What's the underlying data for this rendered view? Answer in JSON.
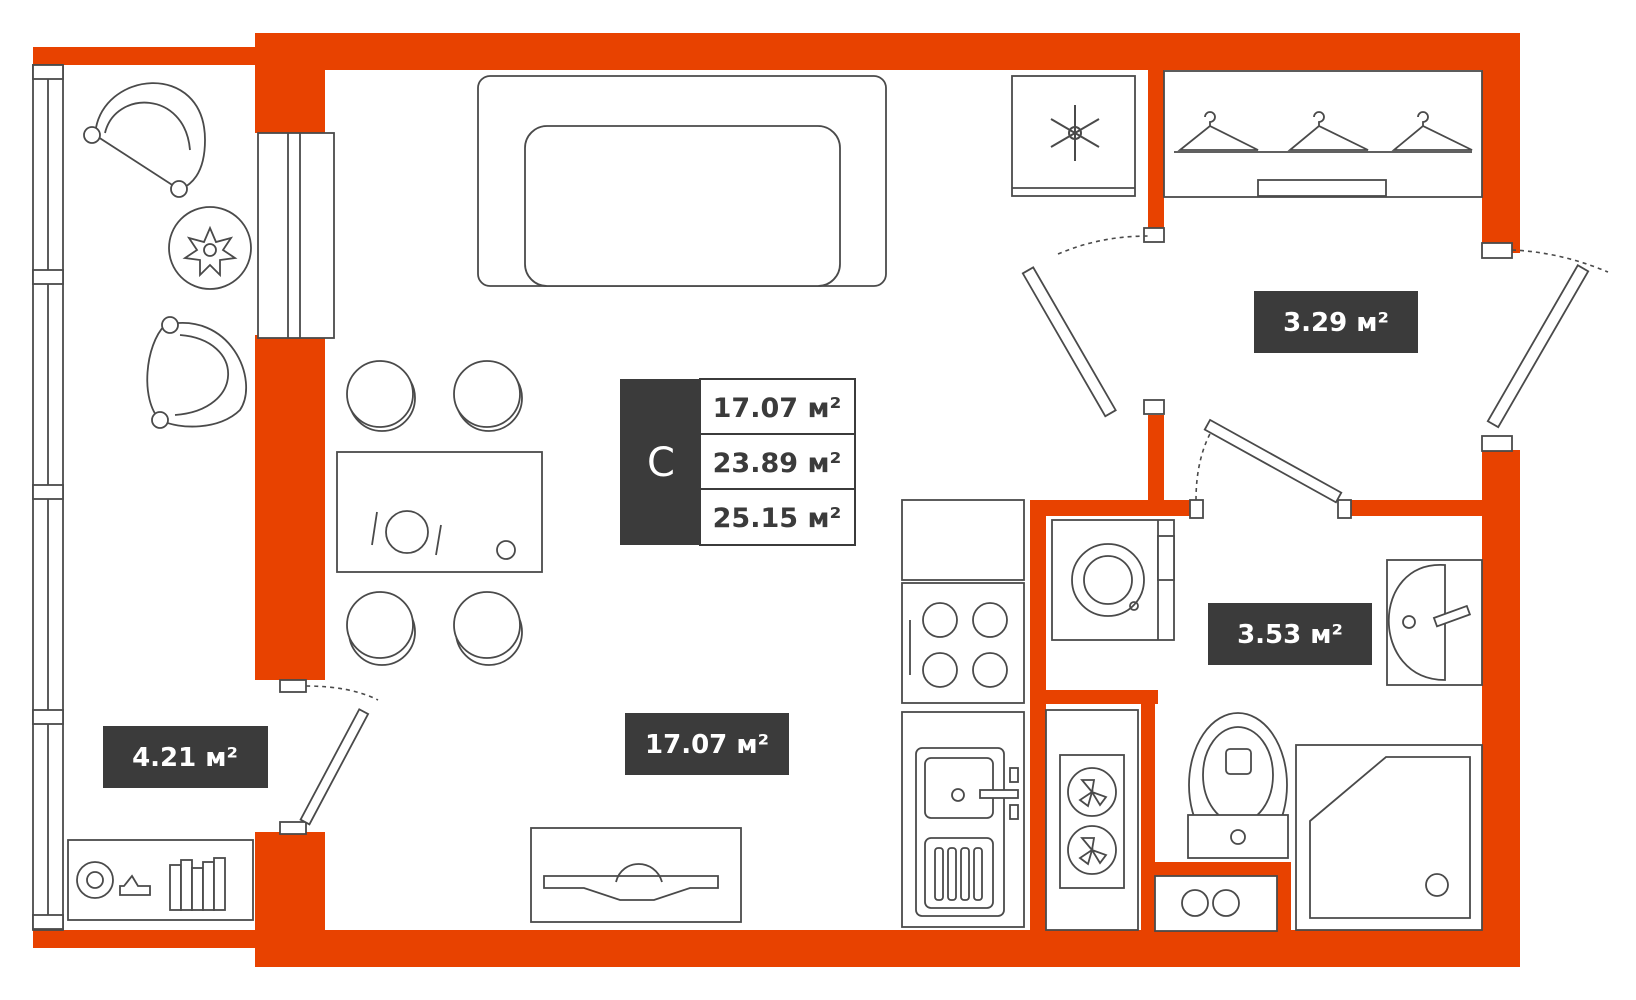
{
  "plan": {
    "colors": {
      "wall": "#e84200",
      "label_bg": "#3b3b3b",
      "line": "#4a4a4a"
    },
    "summary": {
      "type_letter": "С",
      "areas": [
        "17.07 м²",
        "23.89 м²",
        "25.15 м²"
      ]
    },
    "rooms": {
      "main_room": "17.07 м²",
      "balcony": "4.21 м²",
      "hall": "3.29 м²",
      "bathroom": "3.53 м²"
    },
    "icons": [
      "fridge-snowflake-icon",
      "hanger-icon",
      "flower-icon",
      "armchair-icon",
      "sofa-icon",
      "stove-icon",
      "sink-icon",
      "washing-machine-icon",
      "toilet-icon",
      "shower-icon",
      "fan-icon",
      "tv-icon"
    ]
  }
}
